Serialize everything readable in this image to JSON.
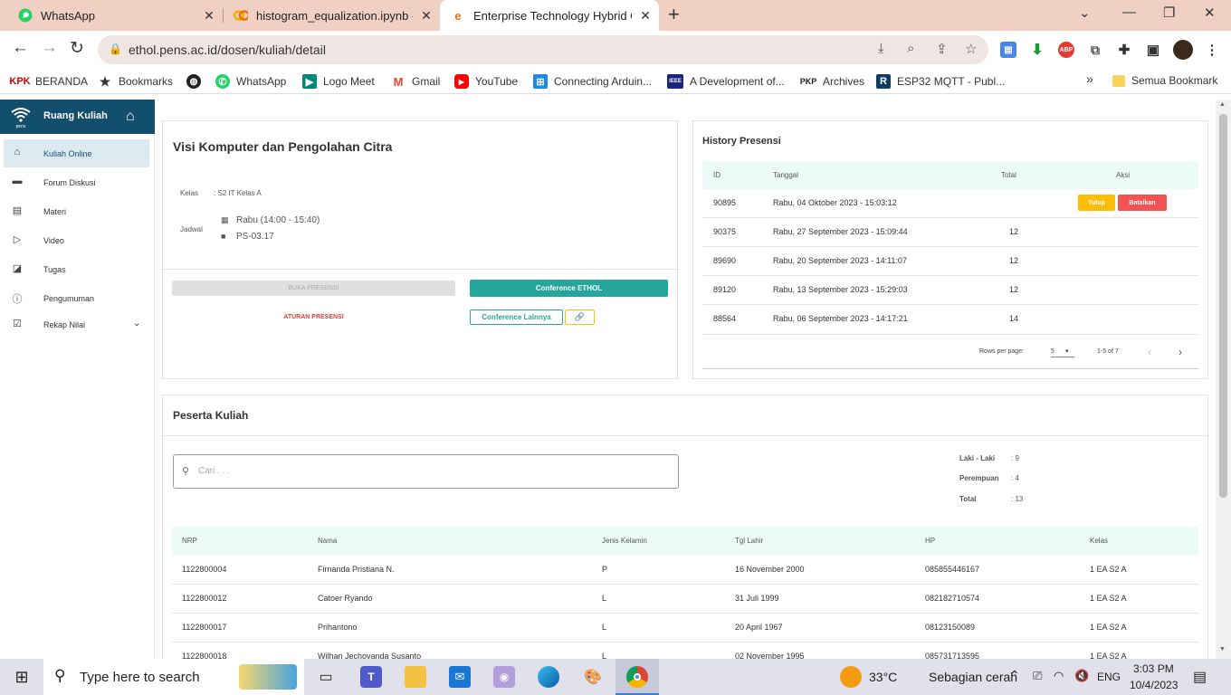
{
  "browser": {
    "tabs": [
      {
        "title": "WhatsApp",
        "icon": "whatsapp-icon"
      },
      {
        "title": "histogram_equalization.ipynb - C",
        "icon": "colab-icon"
      },
      {
        "title": "Enterprise Technology Hybrid O",
        "icon": "ethol-icon"
      }
    ],
    "url": "ethol.pens.ac.id/dosen/kuliah/detail",
    "bookmarks": [
      {
        "label": "BERANDA",
        "icon": "kpk-icon"
      },
      {
        "label": "Bookmarks",
        "icon": "star-icon"
      },
      {
        "label": "",
        "icon": "globe-icon"
      },
      {
        "label": "WhatsApp",
        "icon": "whatsapp-icon"
      },
      {
        "label": "Logo Meet",
        "icon": "meet-icon"
      },
      {
        "label": "Gmail",
        "icon": "gmail-icon"
      },
      {
        "label": "YouTube",
        "icon": "youtube-icon"
      },
      {
        "label": "Connecting Arduin...",
        "icon": "arduino-icon"
      },
      {
        "label": "A Development of...",
        "icon": "ieee-icon"
      },
      {
        "label": "Archives",
        "icon": "pkp-icon"
      },
      {
        "label": "ESP32 MQTT - Publ...",
        "icon": "r-icon"
      }
    ],
    "bookmarks_more": "»",
    "all_bookmarks": "Semua Bookmark"
  },
  "sidebar": {
    "title": "Ruang Kuliah",
    "items": [
      {
        "label": "Kuliah Online",
        "icon": "school-icon"
      },
      {
        "label": "Forum Diskusi",
        "icon": "forum-icon"
      },
      {
        "label": "Materi",
        "icon": "book-icon"
      },
      {
        "label": "Video",
        "icon": "video-icon"
      },
      {
        "label": "Tugas",
        "icon": "task-icon"
      },
      {
        "label": "Pengumuman",
        "icon": "info-icon"
      },
      {
        "label": "Rekap Nilai",
        "icon": "checklist-icon"
      }
    ]
  },
  "course": {
    "title": "Visi Komputer dan Pengolahan Citra",
    "kelas_label": "Kelas",
    "kelas_value": ": S2 IT Kelas A",
    "jadwal_label": "Jadwal",
    "jadwal_time": "Rabu (14:00 - 15:40)",
    "jadwal_room": "PS-03.17",
    "buka_presensi": "BUKA PRESENSI",
    "conference_ethol": "Conference ETHOL",
    "aturan_presensi": "ATURAN PRESENSI",
    "conference_lainnya": "Conference Lainnya",
    "link_icon": "🔗"
  },
  "history": {
    "title": "History Presensi",
    "headers": [
      "ID",
      "Tanggal",
      "Total",
      "Aksi"
    ],
    "rows": [
      {
        "id": "90895",
        "tanggal": "Rabu, 04 Oktober 2023 - 15:03:12",
        "total": ""
      },
      {
        "id": "90375",
        "tanggal": "Rabu, 27 September 2023 - 15:09:44",
        "total": "12"
      },
      {
        "id": "89690",
        "tanggal": "Rabu, 20 September 2023 - 14:11:07",
        "total": "12"
      },
      {
        "id": "89120",
        "tanggal": "Rabu, 13 September 2023 - 15:29:03",
        "total": "12"
      },
      {
        "id": "88564",
        "tanggal": "Rabu, 06 September 2023 - 14:17:21",
        "total": "14"
      }
    ],
    "btn_tutup": "Tutup",
    "btn_batalkan": "Batalkan",
    "rows_per_page_label": "Rows per page:",
    "rows_per_page": "5",
    "range": "1-5 of 7"
  },
  "peserta": {
    "title": "Peserta Kuliah",
    "search_placeholder": "Cari . . .",
    "stats": [
      {
        "label": "Laki - Laki",
        "value": ": 9"
      },
      {
        "label": "Perempuan",
        "value": ": 4"
      },
      {
        "label": "Total",
        "value": ": 13"
      }
    ],
    "headers": [
      "NRP",
      "Nama",
      "Jenis Kelamin",
      "Tgl Lahir",
      "HP",
      "Kelas"
    ],
    "rows": [
      [
        "1122800004",
        "Firnanda Pristiana N.",
        "P",
        "16 November 2000",
        "085855446167",
        "1 EA S2 A"
      ],
      [
        "1122800012",
        "Catoer Ryando",
        "L",
        "31 Juli 1999",
        "082182710574",
        "1 EA S2 A"
      ],
      [
        "1122800017",
        "Prihantono",
        "L",
        "20 April 1967",
        "08123150089",
        "1 EA S2 A"
      ],
      [
        "1122800018",
        "Wilhan Jechovanda Susanto",
        "L",
        "02 November 1995",
        "085731713595",
        "1 EA S2 A"
      ]
    ]
  },
  "taskbar": {
    "search_placeholder": "Type here to search",
    "weather_temp": "33°C",
    "weather_desc": "Sebagian cerah",
    "lang": "ENG",
    "time": "3:03 PM",
    "date": "10/4/2023"
  },
  "colors": {
    "teal": "#26a69a",
    "sidebar_header": "#124f6d",
    "tutup": "#ffbd07",
    "batalkan": "#f35353",
    "aturan": "#e0443c"
  }
}
